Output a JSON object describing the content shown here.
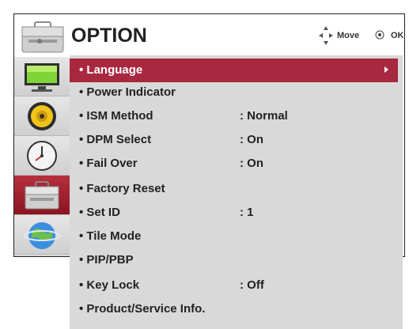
{
  "header": {
    "title": "OPTION",
    "move_hint": "Move",
    "ok_hint": "OK"
  },
  "sidebar": {
    "items": [
      {
        "icon": "picture-icon"
      },
      {
        "icon": "sound-icon"
      },
      {
        "icon": "time-icon"
      },
      {
        "icon": "option-icon",
        "active": true
      },
      {
        "icon": "network-icon"
      }
    ]
  },
  "menu": {
    "items": [
      {
        "label": "• Language",
        "value": "",
        "selected": true
      },
      {
        "label": "• Power Indicator",
        "value": ""
      },
      {
        "label": "• ISM Method",
        "value": ": Normal"
      },
      {
        "label": "• DPM Select",
        "value": ": On"
      },
      {
        "label": "• Fail Over",
        "value": ": On"
      },
      {
        "label": "• Factory Reset",
        "value": ""
      },
      {
        "label": "• Set ID",
        "value": ": 1"
      },
      {
        "label": "• Tile Mode",
        "value": ""
      },
      {
        "label": "• PIP/PBP",
        "value": ""
      },
      {
        "label": "• Key Lock",
        "value": ": Off"
      },
      {
        "label": "• Product/Service Info.",
        "value": ""
      }
    ]
  },
  "colors": {
    "selected_bg": "#a8283f",
    "panel_bg": "#d9d9d9"
  }
}
